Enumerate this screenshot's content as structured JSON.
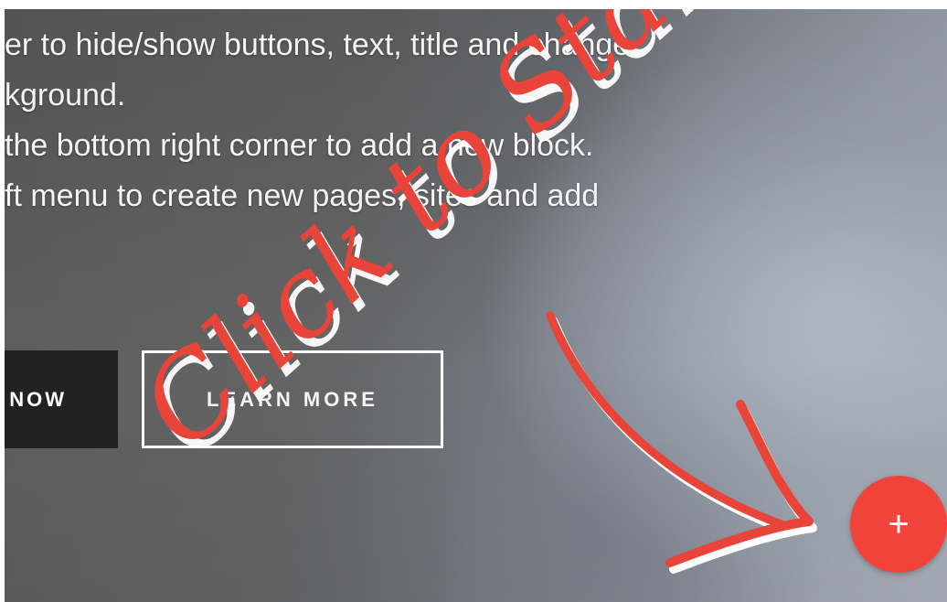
{
  "hero": {
    "lines": [
      "er to hide/show buttons, text, title and change",
      "kground.",
      " the bottom right corner to add a new block.",
      "ft menu to create new pages, sites and add"
    ],
    "primary_button_label": "NOW",
    "secondary_button_label": "LEARN MORE"
  },
  "annotation": {
    "text": "Click to Start",
    "color": "#e8443a"
  },
  "add_button": {
    "label": "+",
    "icon": "plus-icon",
    "color": "#f2433a"
  }
}
